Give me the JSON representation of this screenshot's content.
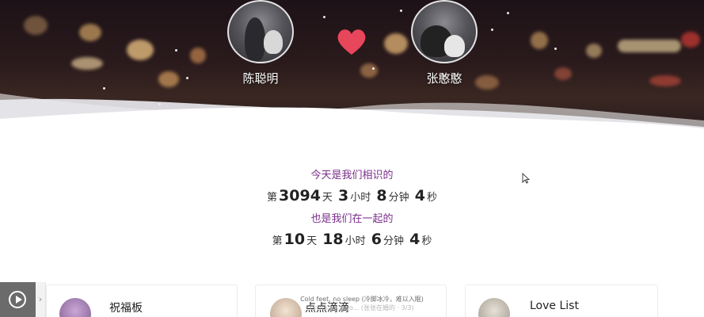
{
  "couple": {
    "left_name": "陈聪明",
    "right_name": "张憨憨"
  },
  "counter": {
    "met_label": "今天是我们相识的",
    "met": {
      "prefix": "第",
      "days": "3094",
      "days_unit": "天",
      "hours": "3",
      "hours_unit": "小时",
      "minutes": "8",
      "minutes_unit": "分钟",
      "seconds": "4",
      "seconds_unit": "秒"
    },
    "together_label": "也是我们在一起的",
    "together": {
      "prefix": "第",
      "days": "10",
      "days_unit": "天",
      "hours": "18",
      "hours_unit": "小时",
      "minutes": "6",
      "minutes_unit": "分钟",
      "seconds": "4",
      "seconds_unit": "秒"
    }
  },
  "cards": [
    {
      "title": "祝福板",
      "icon": "blessing-board-avatar"
    },
    {
      "title": "点点滴滴",
      "icon": "moments-avatar"
    },
    {
      "title": "Love List",
      "icon": "love-list-avatar"
    }
  ],
  "music": {
    "expand_glyph": "›",
    "lyric_line_1": "Cold feet, no sleep (冷脚冰冷，难以入眠)",
    "lyric_line_2": "Lyrics by Invo... (张张在婚的 · 3/3)"
  },
  "colors": {
    "accent_purple": "#7a2f8a",
    "heart": "#e8465a",
    "hero_dark": "#241a1c"
  }
}
